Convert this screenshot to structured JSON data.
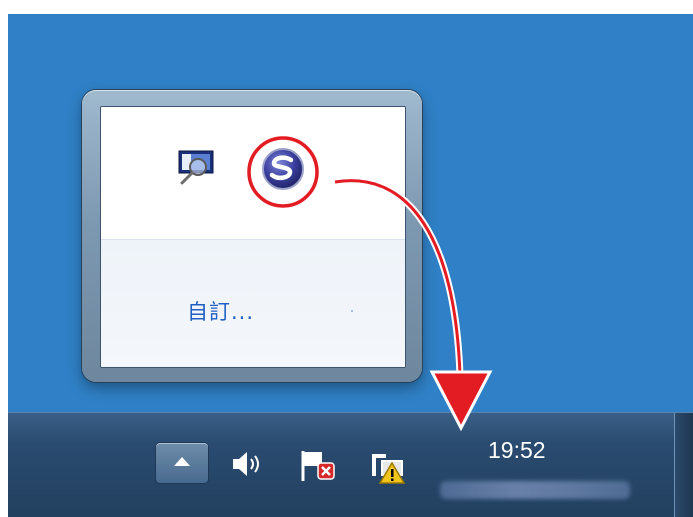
{
  "popup": {
    "customize_label": "自訂..."
  },
  "taskbar": {
    "clock_time": "19:52",
    "show_hidden_icon": "chevron-up-icon",
    "tray_icons": [
      "volume-icon",
      "action-center-flag-icon",
      "network-warning-icon"
    ]
  },
  "popup_icons": [
    "magnifier-screen-icon",
    "scansnap-manager-icon"
  ],
  "colors": {
    "desktop": "#2f80c6",
    "taskbar": "#22405f",
    "highlight": "#e31b23",
    "link": "#1f5fc4"
  }
}
